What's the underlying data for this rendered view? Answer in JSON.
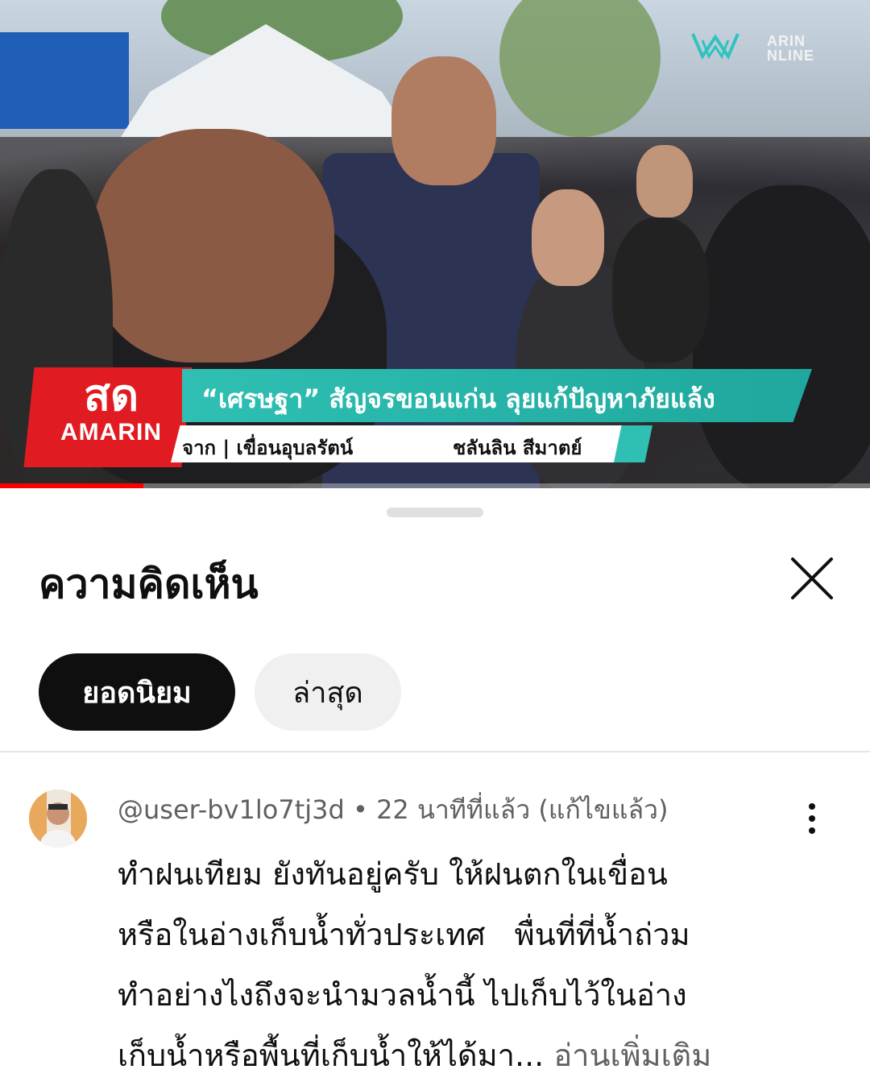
{
  "video": {
    "live_label": "สด",
    "brand": "AMARIN",
    "channel_watermark": "ARIN\nNLINE",
    "headline": "“เศรษฐา” สัญจรขอนแก่น ลุยแก้ปัญหาภัยแล้ง",
    "location": "จาก | เขื่อนอุบลรัตน์",
    "reporter": "ชลันลิน สีมาตย์",
    "progress": 0.165,
    "colors": {
      "live_red": "#e11b22",
      "teal": "#2fbfb3",
      "progress_red": "#ff0000"
    }
  },
  "comments_panel": {
    "title": "ความคิดเห็น",
    "close_icon": "close-icon",
    "sort_chips": [
      {
        "label": "ยอดนิยม",
        "selected": true
      },
      {
        "label": "ล่าสุด",
        "selected": false
      }
    ],
    "comments": [
      {
        "author": "@user-bv1lo7tj3d",
        "time": "22 นาทีที่แล้ว (แก้ไขแล้ว)",
        "text_lines": [
          "ทำฝนเทียม ยังทันอยู่ครับ ให้ฝนตกในเขื่อน",
          "หรือในอ่างเก็บน้ำทั่วประเทศ   พื่นที่ที่น้ำถ่วม",
          "ทำอย่างไงถึงจะนำมวลน้ำนี้ ไปเก็บไว้ในอ่าง",
          "เก็บน้ำหรือพื้นที่เก็บน้ำให้ได้มา..."
        ],
        "read_more": "อ่านเพิ่มเติม",
        "menu_icon": "more-vert-icon"
      }
    ]
  }
}
